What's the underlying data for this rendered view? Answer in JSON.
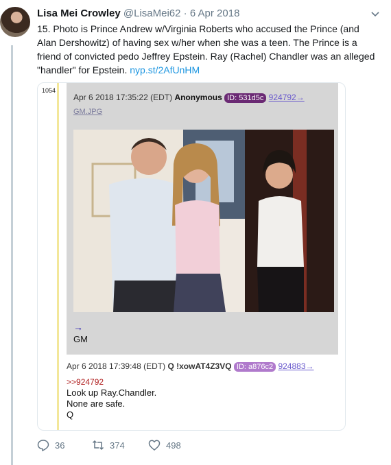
{
  "tweet": {
    "author_name": "Lisa Mei Crowley",
    "handle": "@LisaMei62",
    "separator": "·",
    "date": "6 Apr 2018",
    "text_before_link": "15. Photo is Prince Andrew w/Virginia Roberts who accused the Prince (and Alan Dershowitz) of having sex w/her when she was a teen. The Prince is a friend of convicted pedo Jeffrey Epstein. Ray (Rachel) Chandler was an alleged \"handler\" for Epstein. ",
    "link_text": "nyp.st/2AfUnHM"
  },
  "embed": {
    "post_number": "1054",
    "post1": {
      "timestamp": "Apr 6 2018 17:35:22 (EDT)",
      "poster": "Anonymous",
      "id_label": "ID: 531d5c",
      "reflink": "924792→",
      "filename": "GM.JPG",
      "arrow": "→",
      "body": "GM"
    },
    "post2": {
      "timestamp": "Apr 6 2018 17:39:48 (EDT)",
      "poster": "Q !xowAT4Z3VQ",
      "id_label": "ID: a876c2",
      "reflink": "924883→",
      "quote": ">>924792",
      "lines": [
        "Look up Ray.Chandler.",
        "None are safe.",
        "Q"
      ]
    }
  },
  "actions": {
    "replies": "36",
    "retweets": "374",
    "likes": "498"
  },
  "colors": {
    "link": "#1b95e0",
    "id1": "#6b2a74",
    "id2": "#b07acc",
    "quote": "#b02020",
    "yellow_bar": "#f3e79a"
  }
}
